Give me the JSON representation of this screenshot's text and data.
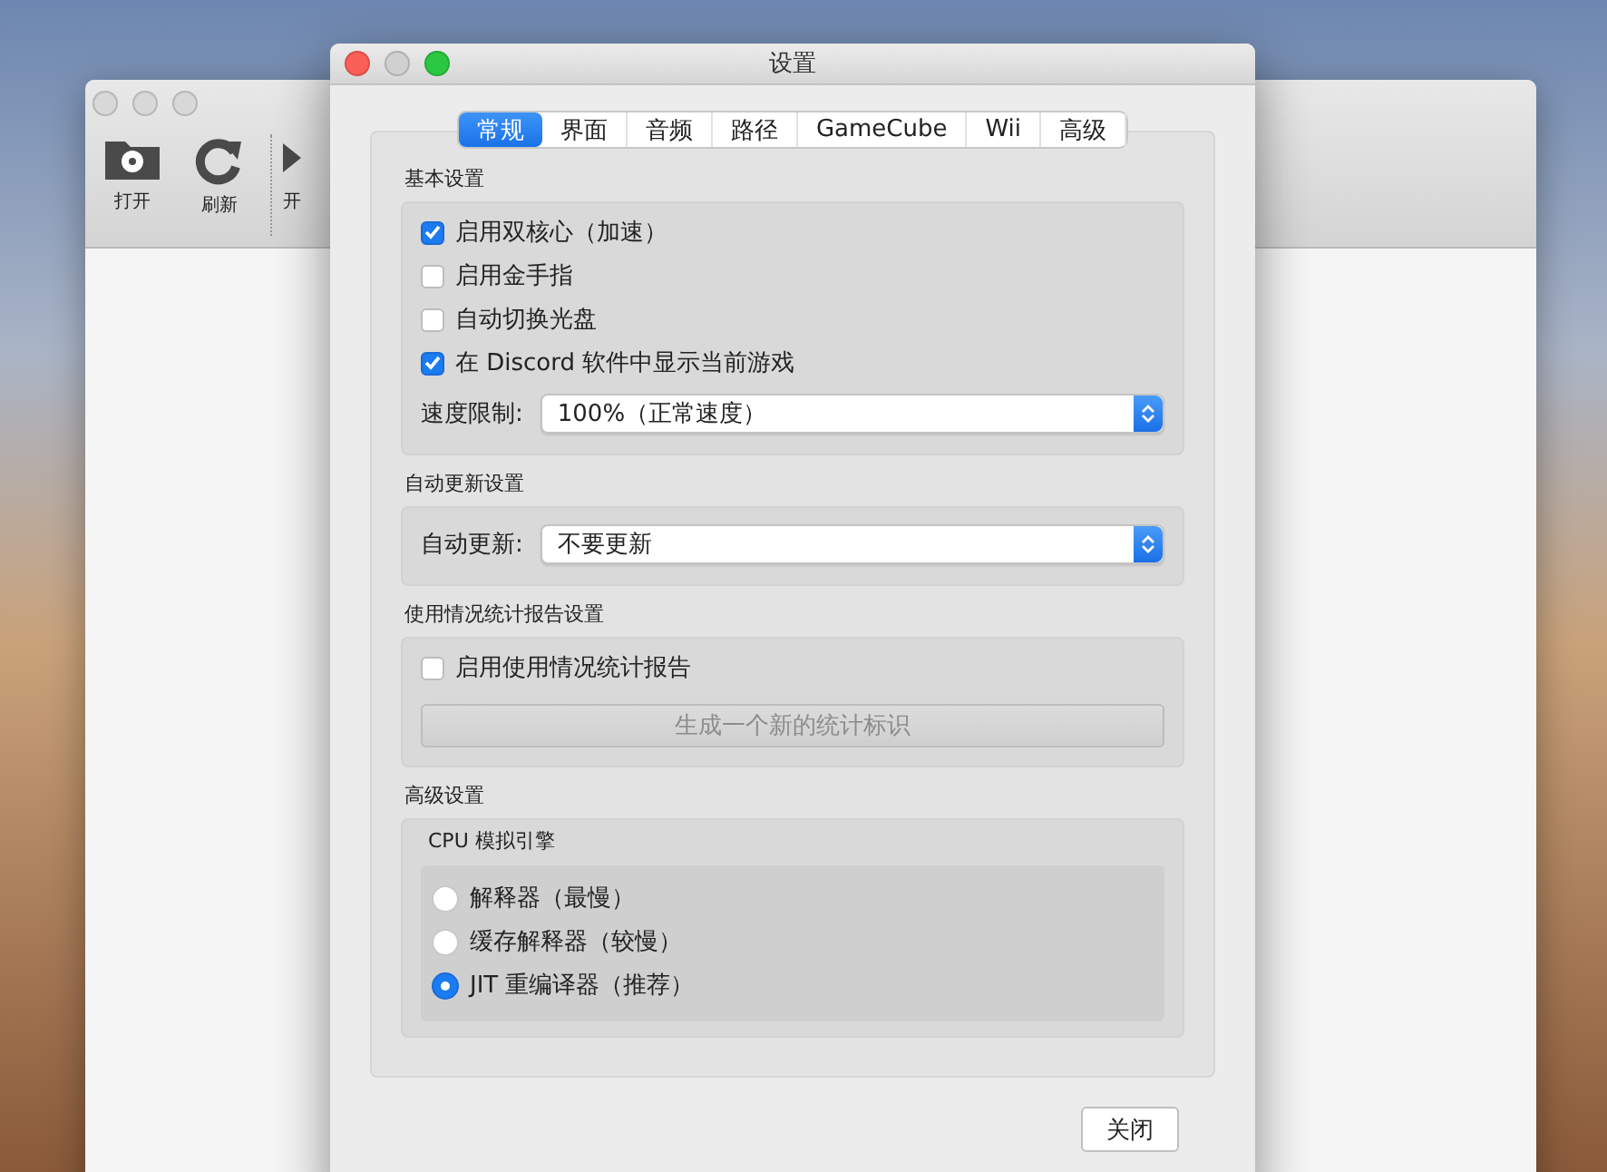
{
  "back_window": {
    "toolbar": [
      {
        "label": "打开",
        "kind": "folder"
      },
      {
        "label": "刷新",
        "kind": "refresh"
      },
      {
        "label": "开",
        "kind": "play"
      }
    ]
  },
  "dialog": {
    "title": "设置",
    "tabs": [
      {
        "label": "常规",
        "selected": true
      },
      {
        "label": "界面",
        "selected": false
      },
      {
        "label": "音频",
        "selected": false
      },
      {
        "label": "路径",
        "selected": false
      },
      {
        "label": "GameCube",
        "selected": false
      },
      {
        "label": "Wii",
        "selected": false
      },
      {
        "label": "高级",
        "selected": false
      }
    ],
    "sections": [
      {
        "title": "基本设置",
        "items": [
          {
            "kind": "checkbox",
            "label": "启用双核心（加速）",
            "checked": true
          },
          {
            "kind": "checkbox",
            "label": "启用金手指",
            "checked": false
          },
          {
            "kind": "checkbox",
            "label": "自动切换光盘",
            "checked": false
          },
          {
            "kind": "checkbox",
            "label": "在 Discord 软件中显示当前游戏",
            "checked": true
          },
          {
            "kind": "select",
            "label": "速度限制:",
            "value": "100%（正常速度）"
          }
        ]
      },
      {
        "title": "自动更新设置",
        "items": [
          {
            "kind": "select",
            "label": "自动更新:",
            "value": "不要更新"
          }
        ]
      },
      {
        "title": "使用情况统计报告设置",
        "items": [
          {
            "kind": "checkbox",
            "label": "启用使用情况统计报告",
            "checked": false
          },
          {
            "kind": "button",
            "label": "生成一个新的统计标识",
            "disabled": true
          }
        ]
      },
      {
        "title": "高级设置",
        "items": [
          {
            "kind": "radios",
            "title": "CPU 模拟引擎",
            "options": [
              {
                "label": "解释器（最慢）",
                "selected": false
              },
              {
                "label": "缓存解释器（较慢）",
                "selected": false
              },
              {
                "label": "JIT 重编译器（推荐）",
                "selected": true
              }
            ]
          }
        ]
      }
    ],
    "close_button": "关闭"
  }
}
